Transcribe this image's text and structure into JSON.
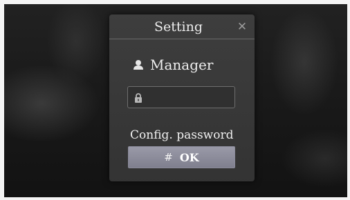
{
  "dialog": {
    "title": "Setting",
    "close_icon": "close-icon",
    "close_glyph": "✕"
  },
  "user": {
    "icon": "user-icon",
    "name": "Manager"
  },
  "password_field": {
    "icon": "lock-icon",
    "value": "",
    "placeholder": ""
  },
  "config_link": {
    "label": "Config. password"
  },
  "ok_button": {
    "hash": "#",
    "label": "OK"
  }
}
